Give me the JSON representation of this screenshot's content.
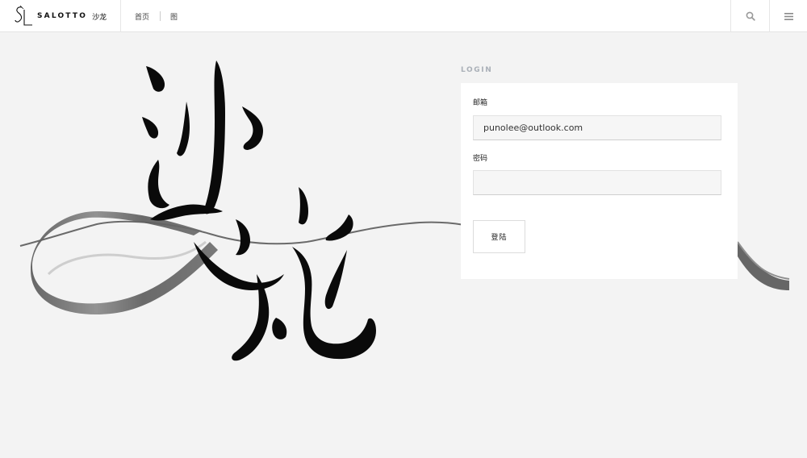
{
  "header": {
    "brand": "SALOTTO",
    "brand_cn": "沙龙",
    "nav": [
      {
        "label": "首页"
      },
      {
        "label": "图"
      }
    ],
    "icons": {
      "search": "search-icon",
      "menu": "menu-icon"
    }
  },
  "login": {
    "heading": "LOGIN",
    "email_label": "邮箱",
    "email_value": "punolee@outlook.com",
    "password_label": "密码",
    "password_value": "",
    "submit_label": "登陆"
  },
  "colors": {
    "background": "#f3f3f3",
    "header": "#ffffff",
    "heading": "#aab0b8"
  }
}
